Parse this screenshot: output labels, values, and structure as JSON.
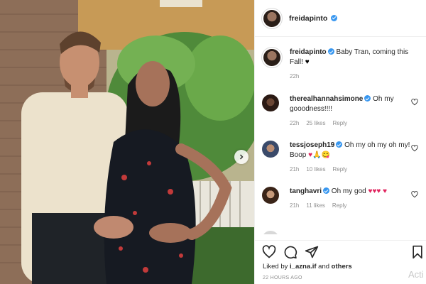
{
  "post": {
    "username": "freidapinto",
    "caption": "Baby Tran, coming this Fall!",
    "caption_emoji": "♥",
    "caption_time": "22h"
  },
  "comments": [
    {
      "username": "therealhannahsimone",
      "text": "Oh my gooodness!!!!",
      "time": "22h",
      "likes": "25 likes",
      "reply": "Reply"
    },
    {
      "username": "tessjoseph19",
      "text": "Oh my oh my oh my! Boop",
      "emoji": "♥🙏😋",
      "time": "21h",
      "likes": "10 likes",
      "reply": "Reply"
    },
    {
      "username": "tanghavri",
      "text": "Oh my god",
      "emoji": "♥♥♥ ♥",
      "time": "21h",
      "likes": "11 likes",
      "reply": "Reply"
    }
  ],
  "footer": {
    "liked_by_prefix": "Liked by",
    "liked_by_user": "i_azna.if",
    "liked_by_mid": "and",
    "liked_by_others": "others",
    "post_age": "22 HOURS AGO",
    "watermark": "Acti"
  },
  "icons": {
    "like": "heart-icon",
    "comment": "comment-icon",
    "share": "share-icon",
    "save": "bookmark-icon",
    "next": "chevron-right-icon"
  },
  "colors": {
    "verified": "#3897f0",
    "text": "#262626",
    "muted": "#8e8e8e",
    "heart": "#e0245e"
  }
}
